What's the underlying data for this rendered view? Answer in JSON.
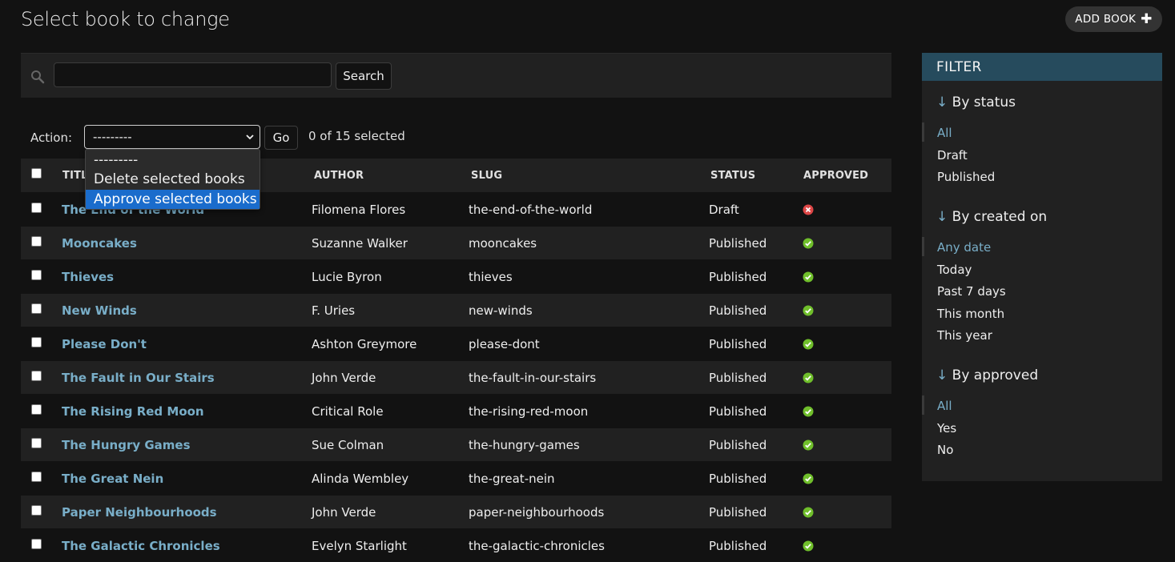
{
  "page": {
    "title": "Select book to change",
    "add_button_label": "ADD BOOK"
  },
  "search": {
    "value": "",
    "placeholder": "",
    "button_label": "Search"
  },
  "actions": {
    "label": "Action:",
    "selected_value": "---------",
    "go_label": "Go",
    "selected_count": "0 of 15 selected",
    "options": [
      "---------",
      "Delete selected books",
      "Approve selected books"
    ],
    "highlighted_option_index": 2
  },
  "table": {
    "columns": [
      "TITLE",
      "AUTHOR",
      "SLUG",
      "STATUS",
      "APPROVED"
    ],
    "rows": [
      {
        "title": "The End of the World",
        "author": "Filomena Flores",
        "slug": "the-end-of-the-world",
        "status": "Draft",
        "approved": false
      },
      {
        "title": "Mooncakes",
        "author": "Suzanne Walker",
        "slug": "mooncakes",
        "status": "Published",
        "approved": true
      },
      {
        "title": "Thieves",
        "author": "Lucie Byron",
        "slug": "thieves",
        "status": "Published",
        "approved": true
      },
      {
        "title": "New Winds",
        "author": "F. Uries",
        "slug": "new-winds",
        "status": "Published",
        "approved": true
      },
      {
        "title": "Please Don't",
        "author": "Ashton Greymore",
        "slug": "please-dont",
        "status": "Published",
        "approved": true
      },
      {
        "title": "The Fault in Our Stairs",
        "author": "John Verde",
        "slug": "the-fault-in-our-stairs",
        "status": "Published",
        "approved": true
      },
      {
        "title": "The Rising Red Moon",
        "author": "Critical Role",
        "slug": "the-rising-red-moon",
        "status": "Published",
        "approved": true
      },
      {
        "title": "The Hungry Games",
        "author": "Sue Colman",
        "slug": "the-hungry-games",
        "status": "Published",
        "approved": true
      },
      {
        "title": "The Great Nein",
        "author": "Alinda Wembley",
        "slug": "the-great-nein",
        "status": "Published",
        "approved": true
      },
      {
        "title": "Paper Neighbourhoods",
        "author": "John Verde",
        "slug": "paper-neighbourhoods",
        "status": "Published",
        "approved": true
      },
      {
        "title": "The Galactic Chronicles",
        "author": "Evelyn Starlight",
        "slug": "the-galactic-chronicles",
        "status": "Published",
        "approved": true
      }
    ]
  },
  "filter": {
    "heading": "FILTER",
    "arrow": "↓",
    "groups": [
      {
        "title": "By status",
        "options": [
          "All",
          "Draft",
          "Published"
        ],
        "active": 0
      },
      {
        "title": "By created on",
        "options": [
          "Any date",
          "Today",
          "Past 7 days",
          "This month",
          "This year"
        ],
        "active": 0
      },
      {
        "title": "By approved",
        "options": [
          "All",
          "Yes",
          "No"
        ],
        "active": 0
      }
    ]
  },
  "colors": {
    "link": "#79aec8",
    "filter_header": "#264b5d",
    "approved_yes": "#70bf2b",
    "approved_no": "#dd4646",
    "highlight": "#1a6ccc"
  },
  "icons": {
    "search": "search-icon",
    "add": "plus-icon",
    "chevron": "chevron-down-icon",
    "yes": "check-circle-icon",
    "no": "x-circle-icon"
  }
}
